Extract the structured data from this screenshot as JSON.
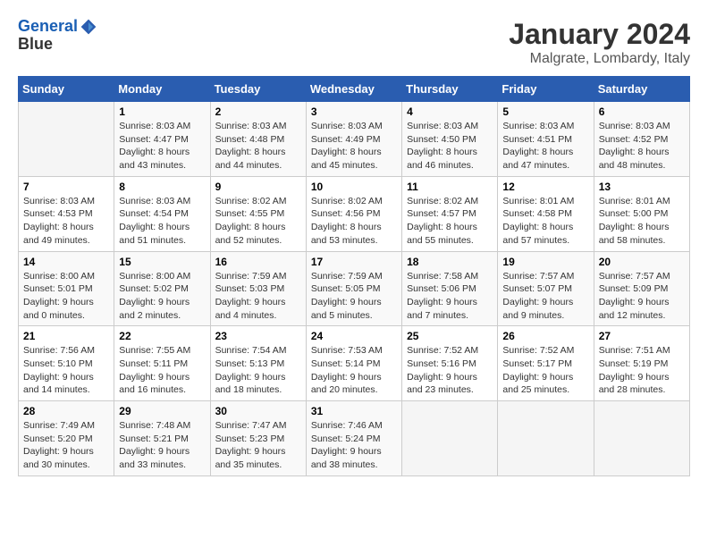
{
  "header": {
    "logo_line1": "General",
    "logo_line2": "Blue",
    "title": "January 2024",
    "subtitle": "Malgrate, Lombardy, Italy"
  },
  "days_of_week": [
    "Sunday",
    "Monday",
    "Tuesday",
    "Wednesday",
    "Thursday",
    "Friday",
    "Saturday"
  ],
  "weeks": [
    [
      {
        "day": "",
        "info": ""
      },
      {
        "day": "1",
        "info": "Sunrise: 8:03 AM\nSunset: 4:47 PM\nDaylight: 8 hours\nand 43 minutes."
      },
      {
        "day": "2",
        "info": "Sunrise: 8:03 AM\nSunset: 4:48 PM\nDaylight: 8 hours\nand 44 minutes."
      },
      {
        "day": "3",
        "info": "Sunrise: 8:03 AM\nSunset: 4:49 PM\nDaylight: 8 hours\nand 45 minutes."
      },
      {
        "day": "4",
        "info": "Sunrise: 8:03 AM\nSunset: 4:50 PM\nDaylight: 8 hours\nand 46 minutes."
      },
      {
        "day": "5",
        "info": "Sunrise: 8:03 AM\nSunset: 4:51 PM\nDaylight: 8 hours\nand 47 minutes."
      },
      {
        "day": "6",
        "info": "Sunrise: 8:03 AM\nSunset: 4:52 PM\nDaylight: 8 hours\nand 48 minutes."
      }
    ],
    [
      {
        "day": "7",
        "info": "Sunrise: 8:03 AM\nSunset: 4:53 PM\nDaylight: 8 hours\nand 49 minutes."
      },
      {
        "day": "8",
        "info": "Sunrise: 8:03 AM\nSunset: 4:54 PM\nDaylight: 8 hours\nand 51 minutes."
      },
      {
        "day": "9",
        "info": "Sunrise: 8:02 AM\nSunset: 4:55 PM\nDaylight: 8 hours\nand 52 minutes."
      },
      {
        "day": "10",
        "info": "Sunrise: 8:02 AM\nSunset: 4:56 PM\nDaylight: 8 hours\nand 53 minutes."
      },
      {
        "day": "11",
        "info": "Sunrise: 8:02 AM\nSunset: 4:57 PM\nDaylight: 8 hours\nand 55 minutes."
      },
      {
        "day": "12",
        "info": "Sunrise: 8:01 AM\nSunset: 4:58 PM\nDaylight: 8 hours\nand 57 minutes."
      },
      {
        "day": "13",
        "info": "Sunrise: 8:01 AM\nSunset: 5:00 PM\nDaylight: 8 hours\nand 58 minutes."
      }
    ],
    [
      {
        "day": "14",
        "info": "Sunrise: 8:00 AM\nSunset: 5:01 PM\nDaylight: 9 hours\nand 0 minutes."
      },
      {
        "day": "15",
        "info": "Sunrise: 8:00 AM\nSunset: 5:02 PM\nDaylight: 9 hours\nand 2 minutes."
      },
      {
        "day": "16",
        "info": "Sunrise: 7:59 AM\nSunset: 5:03 PM\nDaylight: 9 hours\nand 4 minutes."
      },
      {
        "day": "17",
        "info": "Sunrise: 7:59 AM\nSunset: 5:05 PM\nDaylight: 9 hours\nand 5 minutes."
      },
      {
        "day": "18",
        "info": "Sunrise: 7:58 AM\nSunset: 5:06 PM\nDaylight: 9 hours\nand 7 minutes."
      },
      {
        "day": "19",
        "info": "Sunrise: 7:57 AM\nSunset: 5:07 PM\nDaylight: 9 hours\nand 9 minutes."
      },
      {
        "day": "20",
        "info": "Sunrise: 7:57 AM\nSunset: 5:09 PM\nDaylight: 9 hours\nand 12 minutes."
      }
    ],
    [
      {
        "day": "21",
        "info": "Sunrise: 7:56 AM\nSunset: 5:10 PM\nDaylight: 9 hours\nand 14 minutes."
      },
      {
        "day": "22",
        "info": "Sunrise: 7:55 AM\nSunset: 5:11 PM\nDaylight: 9 hours\nand 16 minutes."
      },
      {
        "day": "23",
        "info": "Sunrise: 7:54 AM\nSunset: 5:13 PM\nDaylight: 9 hours\nand 18 minutes."
      },
      {
        "day": "24",
        "info": "Sunrise: 7:53 AM\nSunset: 5:14 PM\nDaylight: 9 hours\nand 20 minutes."
      },
      {
        "day": "25",
        "info": "Sunrise: 7:52 AM\nSunset: 5:16 PM\nDaylight: 9 hours\nand 23 minutes."
      },
      {
        "day": "26",
        "info": "Sunrise: 7:52 AM\nSunset: 5:17 PM\nDaylight: 9 hours\nand 25 minutes."
      },
      {
        "day": "27",
        "info": "Sunrise: 7:51 AM\nSunset: 5:19 PM\nDaylight: 9 hours\nand 28 minutes."
      }
    ],
    [
      {
        "day": "28",
        "info": "Sunrise: 7:49 AM\nSunset: 5:20 PM\nDaylight: 9 hours\nand 30 minutes."
      },
      {
        "day": "29",
        "info": "Sunrise: 7:48 AM\nSunset: 5:21 PM\nDaylight: 9 hours\nand 33 minutes."
      },
      {
        "day": "30",
        "info": "Sunrise: 7:47 AM\nSunset: 5:23 PM\nDaylight: 9 hours\nand 35 minutes."
      },
      {
        "day": "31",
        "info": "Sunrise: 7:46 AM\nSunset: 5:24 PM\nDaylight: 9 hours\nand 38 minutes."
      },
      {
        "day": "",
        "info": ""
      },
      {
        "day": "",
        "info": ""
      },
      {
        "day": "",
        "info": ""
      }
    ]
  ]
}
